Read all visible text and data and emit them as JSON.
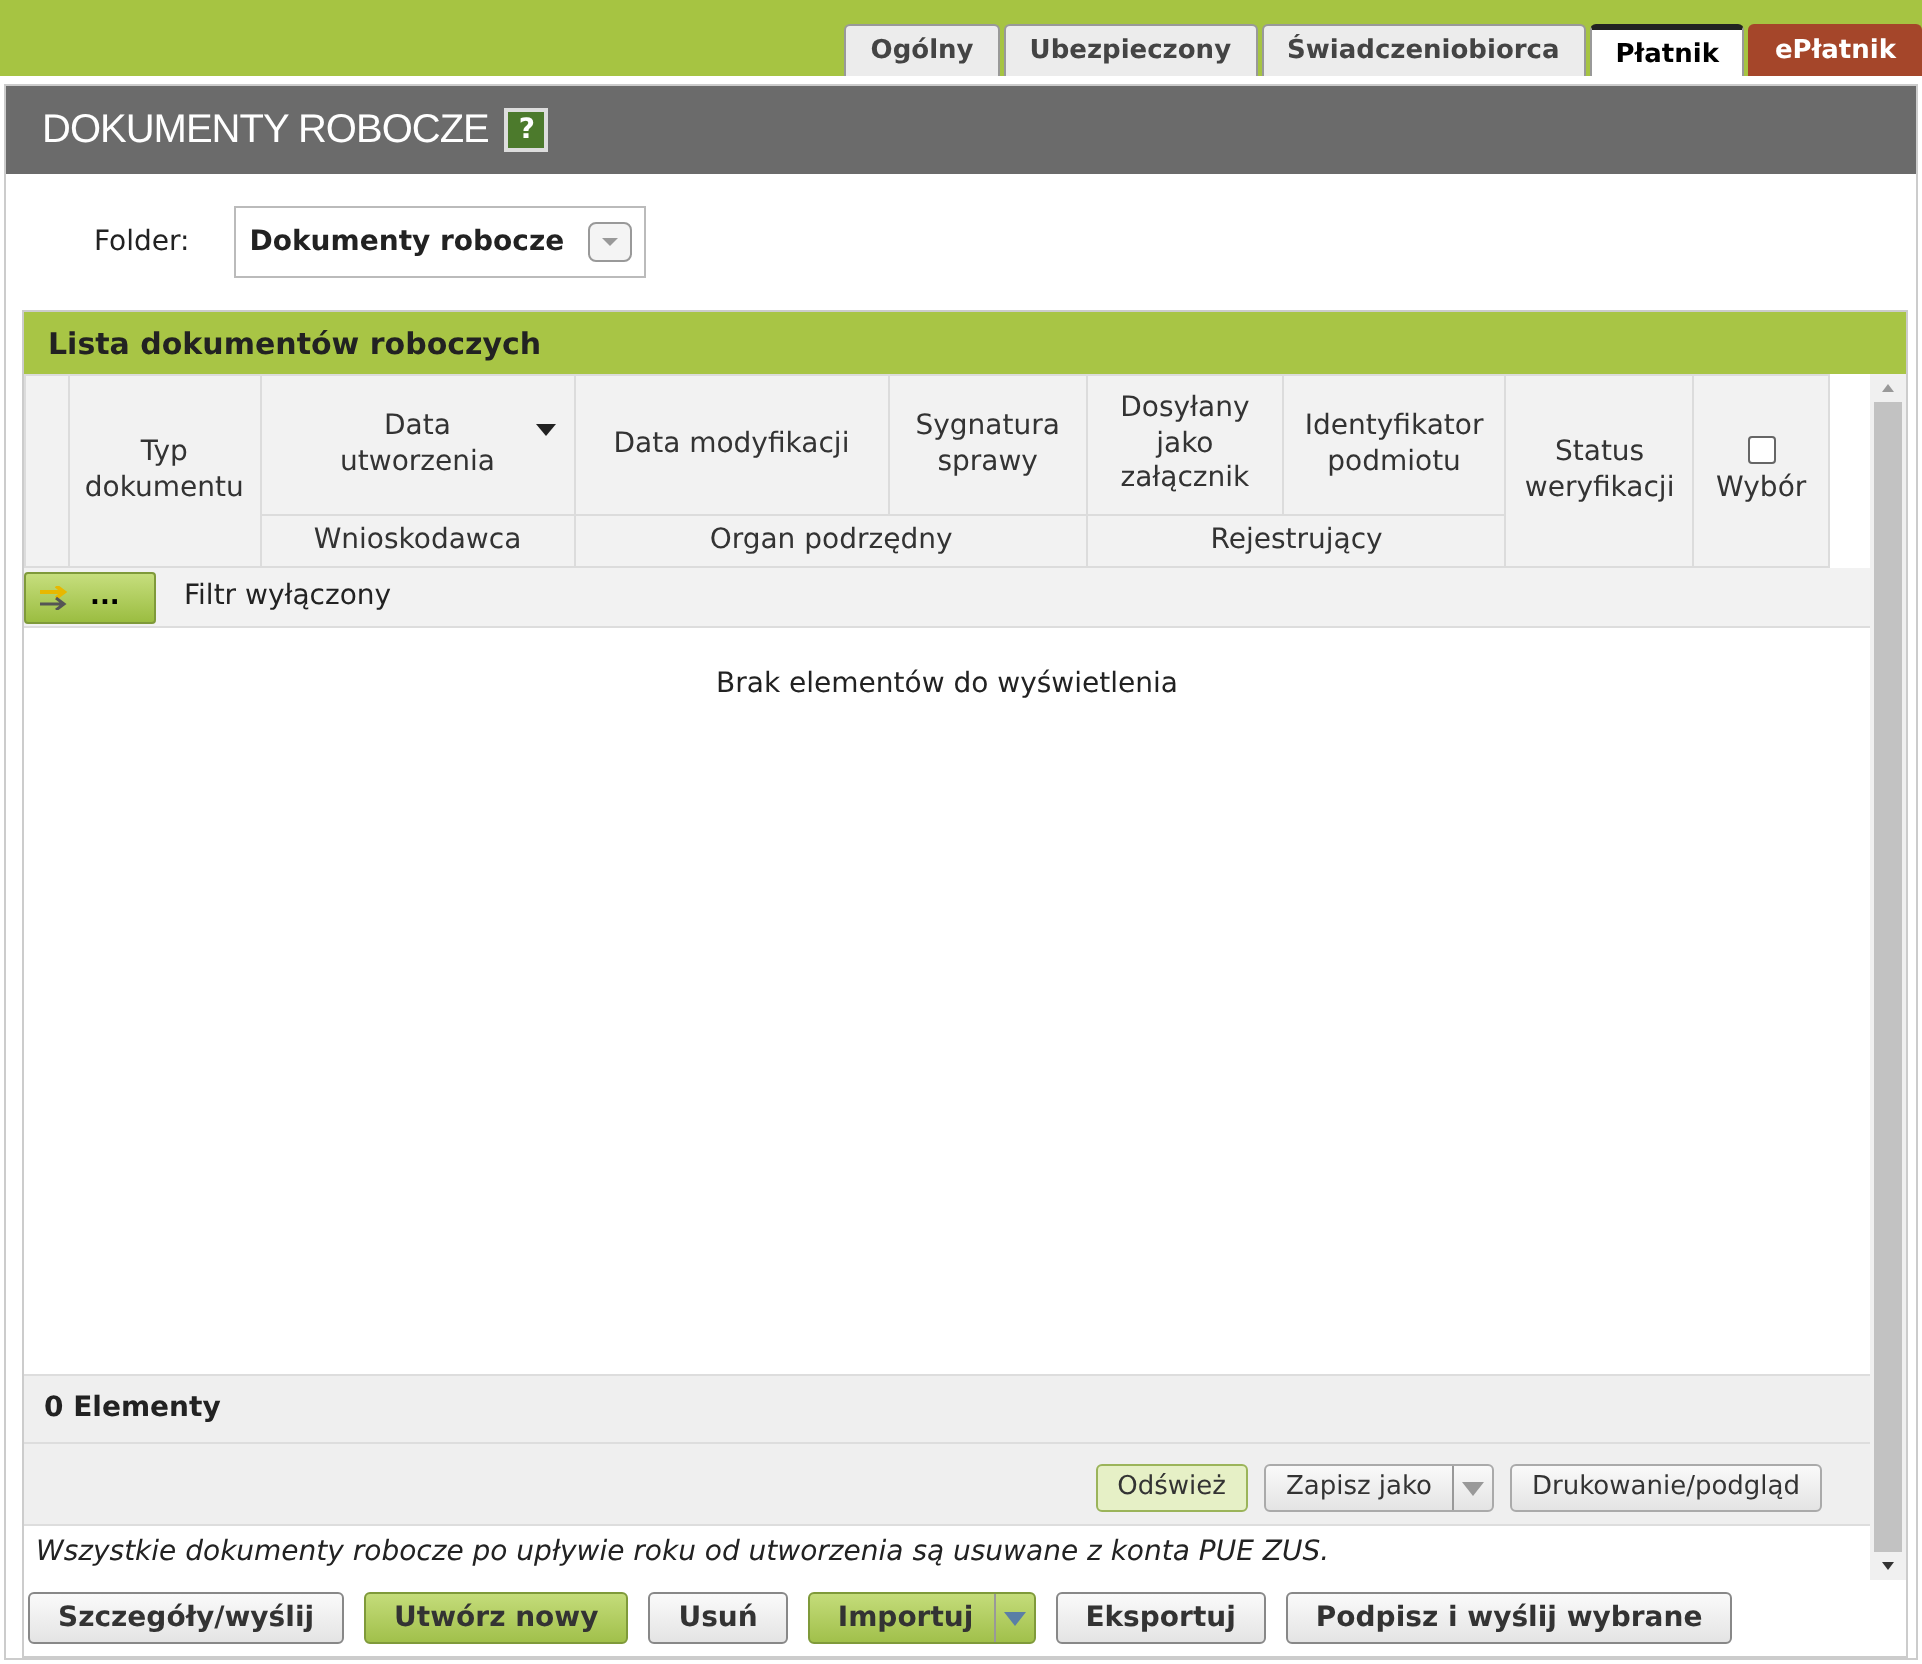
{
  "tabs": [
    {
      "label": "Ogólny",
      "selected": false,
      "kind": "normal"
    },
    {
      "label": "Ubezpieczony",
      "selected": false,
      "kind": "normal"
    },
    {
      "label": "Świadczeniobiorca",
      "selected": false,
      "kind": "normal"
    },
    {
      "label": "Płatnik",
      "selected": true,
      "kind": "normal"
    },
    {
      "label": "ePłatnik",
      "selected": false,
      "kind": "accent"
    }
  ],
  "page_title": "DOKUMENTY ROBOCZE",
  "help_button": "?",
  "folder": {
    "label": "Folder:",
    "value": "Dokumenty robocze"
  },
  "list": {
    "title": "Lista dokumentów roboczych",
    "header_row_1": [
      {
        "label": "Typ dokumentu",
        "rowspan": 2
      },
      {
        "label": "Data utworzenia",
        "sorted": true
      },
      {
        "label": "Data modyfikacji"
      },
      {
        "label": "Sygnatura sprawy"
      },
      {
        "label": "Dosyłany jako załącznik"
      },
      {
        "label": "Identyfikator podmiotu"
      },
      {
        "label": "Status weryfikacji",
        "rowspan": 2
      }
    ],
    "header_row_2": [
      {
        "label": "Wnioskodawca"
      },
      {
        "label": "Organ podrzędny"
      },
      {
        "label": "Rejestrujący"
      }
    ],
    "select_column": {
      "label": "Wybór",
      "checked": false
    },
    "filter_button": "...",
    "filter_status": "Filtr wyłączony",
    "empty_message": "Brak elementów do wyświetlenia",
    "count": "0 Elementy",
    "actions": [
      {
        "label": "Odśwież",
        "kind": "primary",
        "split": false
      },
      {
        "label": "Zapisz jako",
        "kind": "default",
        "split": true
      },
      {
        "label": "Drukowanie/podgląd",
        "kind": "default",
        "split": false
      }
    ],
    "note": "Wszystkie dokumenty robocze po upływie roku od utworzenia są usuwane z konta PUE ZUS."
  },
  "buttons": [
    {
      "label": "Szczegóły/wyślij",
      "kind": "default",
      "split": false
    },
    {
      "label": "Utwórz nowy",
      "kind": "primary",
      "split": false
    },
    {
      "label": "Usuń",
      "kind": "default",
      "split": false
    },
    {
      "label": "Importuj",
      "kind": "primary",
      "split": true
    },
    {
      "label": "Eksportuj",
      "kind": "default",
      "split": false
    },
    {
      "label": "Podpisz i wyślij wybrane",
      "kind": "default",
      "split": false
    }
  ]
}
